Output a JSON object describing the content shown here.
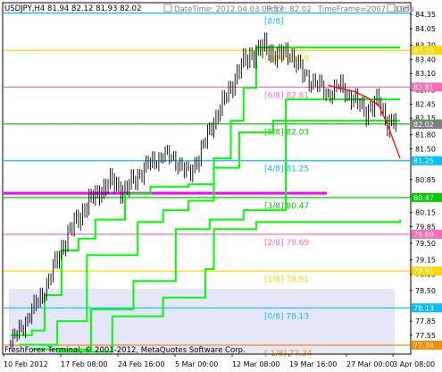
{
  "header": {
    "symbol_info": "USDJPY,H4  81.94 82.12 81.93 82.02",
    "datetime": "DateTime: 2012.04.03 09:57",
    "price": "Price: 82.02",
    "timeframe": "TimeFrame=2007-v0.05",
    "default_tag": "Defa"
  },
  "footer": {
    "copyright": "FreshForex Terminal, © 2001-2012, MetaQuotes Software Corp."
  },
  "colors": {
    "background": "#ffffff",
    "candles": "#000000",
    "trail_line": "#00ff00",
    "moving_average": "#ff0000",
    "shade": "#e6e6fa"
  },
  "chart_data": {
    "type": "line",
    "x_ticks": [
      {
        "label": "10 Feb 2012",
        "bar": 0
      },
      {
        "label": "17 Feb 08:00",
        "bar": 27
      },
      {
        "label": "24 Feb 16:00",
        "bar": 54
      },
      {
        "label": "5 Mar 00:00",
        "bar": 81
      },
      {
        "label": "12 Mar 08:00",
        "bar": 108
      },
      {
        "label": "19 Mar 16:00",
        "bar": 135
      },
      {
        "label": "27 Mar 00:00",
        "bar": 162
      },
      {
        "label": "3 Apr 08:00",
        "bar": 184
      }
    ],
    "y_ticks": [
      84.35,
      84.05,
      83.7,
      83.4,
      83.1,
      82.75,
      82.45,
      82.15,
      81.8,
      81.5,
      80.85,
      80.5,
      80.15,
      79.85,
      79.5,
      79.15,
      78.85,
      78.5,
      77.85,
      77.55
    ],
    "ylim": [
      77.15,
      84.6
    ],
    "bars_total": 187,
    "murrey_levels": [
      {
        "label": "[8/8]",
        "value": 84.38,
        "price_tag": "",
        "color": "#00bfff"
      },
      {
        "label": "[7/8]",
        "value": 83.59,
        "price_tag": "83.59",
        "color": "#ffd700"
      },
      {
        "label": "[6/8]",
        "value": 82.81,
        "price_tag": "82.81",
        "color": "#ff69b4"
      },
      {
        "label": "[5/8]",
        "value": 82.03,
        "price_tag": "82.03",
        "color": "#00cc00"
      },
      {
        "label": "[4/8]",
        "value": 81.25,
        "price_tag": "81.25",
        "color": "#00bfff"
      },
      {
        "label": "[3/8]",
        "value": 80.47,
        "price_tag": "80.47",
        "color": "#00cc00"
      },
      {
        "label": "[2/8]",
        "value": 79.69,
        "price_tag": "79.69",
        "color": "#ff69b4"
      },
      {
        "label": "[1/8]",
        "value": 78.91,
        "price_tag": "78.91",
        "color": "#ffd700"
      },
      {
        "label": "[0/8]",
        "value": 78.13,
        "price_tag": "78.13",
        "color": "#00bfff"
      },
      {
        "label": "[-1/8]",
        "value": 77.34,
        "price_tag": "77.34",
        "color": "#ff8c00"
      }
    ],
    "magenta_line": {
      "value": 80.56,
      "color": "#ff00ff"
    },
    "current_price": {
      "value": 82.02,
      "color": "#808080"
    },
    "price_series": [
      {
        "bar": 0,
        "value": 77.4
      },
      {
        "bar": 6,
        "value": 77.8
      },
      {
        "bar": 12,
        "value": 78.2
      },
      {
        "bar": 18,
        "value": 78.7
      },
      {
        "bar": 24,
        "value": 79.4
      },
      {
        "bar": 30,
        "value": 79.9
      },
      {
        "bar": 36,
        "value": 80.3
      },
      {
        "bar": 42,
        "value": 80.6
      },
      {
        "bar": 48,
        "value": 80.8
      },
      {
        "bar": 54,
        "value": 80.6
      },
      {
        "bar": 60,
        "value": 80.95
      },
      {
        "bar": 66,
        "value": 81.2
      },
      {
        "bar": 72,
        "value": 81.4
      },
      {
        "bar": 78,
        "value": 81.3
      },
      {
        "bar": 84,
        "value": 80.95
      },
      {
        "bar": 90,
        "value": 81.45
      },
      {
        "bar": 96,
        "value": 82.1
      },
      {
        "bar": 102,
        "value": 82.6
      },
      {
        "bar": 108,
        "value": 83.2
      },
      {
        "bar": 114,
        "value": 83.5
      },
      {
        "bar": 120,
        "value": 83.65
      },
      {
        "bar": 126,
        "value": 83.45
      },
      {
        "bar": 132,
        "value": 83.55
      },
      {
        "bar": 138,
        "value": 83.1
      },
      {
        "bar": 144,
        "value": 82.9
      },
      {
        "bar": 150,
        "value": 82.7
      },
      {
        "bar": 156,
        "value": 82.85
      },
      {
        "bar": 162,
        "value": 82.55
      },
      {
        "bar": 168,
        "value": 82.3
      },
      {
        "bar": 174,
        "value": 82.5
      },
      {
        "bar": 178,
        "value": 82.05
      },
      {
        "bar": 182,
        "value": 82.02
      }
    ],
    "moving_average": [
      {
        "bar": 150,
        "value": 82.85
      },
      {
        "bar": 156,
        "value": 82.78
      },
      {
        "bar": 162,
        "value": 82.72
      },
      {
        "bar": 168,
        "value": 82.6
      },
      {
        "bar": 174,
        "value": 82.42
      },
      {
        "bar": 178,
        "value": 82.02
      },
      {
        "bar": 184,
        "value": 81.3
      }
    ],
    "stop_lines": [
      [
        {
          "bar": 0,
          "value": 77.55
        },
        {
          "bar": 10,
          "value": 77.65
        },
        {
          "bar": 16,
          "value": 78.4
        },
        {
          "bar": 24,
          "value": 79.35
        },
        {
          "bar": 32,
          "value": 79.6
        },
        {
          "bar": 40,
          "value": 80.0
        },
        {
          "bar": 54,
          "value": 80.55
        },
        {
          "bar": 66,
          "value": 80.7
        },
        {
          "bar": 84,
          "value": 80.75
        },
        {
          "bar": 96,
          "value": 81.3
        },
        {
          "bar": 104,
          "value": 82.1
        },
        {
          "bar": 110,
          "value": 82.8
        },
        {
          "bar": 116,
          "value": 83.65
        },
        {
          "bar": 184,
          "value": 83.65
        }
      ],
      [
        {
          "bar": 4,
          "value": 77.35
        },
        {
          "bar": 22,
          "value": 77.85
        },
        {
          "bar": 36,
          "value": 79.25
        },
        {
          "bar": 60,
          "value": 79.95
        },
        {
          "bar": 72,
          "value": 80.2
        },
        {
          "bar": 84,
          "value": 80.4
        },
        {
          "bar": 96,
          "value": 81.1
        },
        {
          "bar": 108,
          "value": 81.85
        },
        {
          "bar": 124,
          "value": 82.1
        },
        {
          "bar": 184,
          "value": 82.1
        }
      ],
      [
        {
          "bar": 10,
          "value": 77.25
        },
        {
          "bar": 38,
          "value": 78.1
        },
        {
          "bar": 58,
          "value": 78.7
        },
        {
          "bar": 78,
          "value": 79.8
        },
        {
          "bar": 94,
          "value": 80.0
        },
        {
          "bar": 110,
          "value": 80.2
        },
        {
          "bar": 130,
          "value": 82.55
        },
        {
          "bar": 184,
          "value": 82.55
        }
      ],
      [
        {
          "bar": 22,
          "value": 77.2
        },
        {
          "bar": 48,
          "value": 77.95
        },
        {
          "bar": 72,
          "value": 78.35
        },
        {
          "bar": 92,
          "value": 78.95
        },
        {
          "bar": 96,
          "value": 79.8
        },
        {
          "bar": 116,
          "value": 79.95
        },
        {
          "bar": 184,
          "value": 80.0
        }
      ]
    ]
  }
}
